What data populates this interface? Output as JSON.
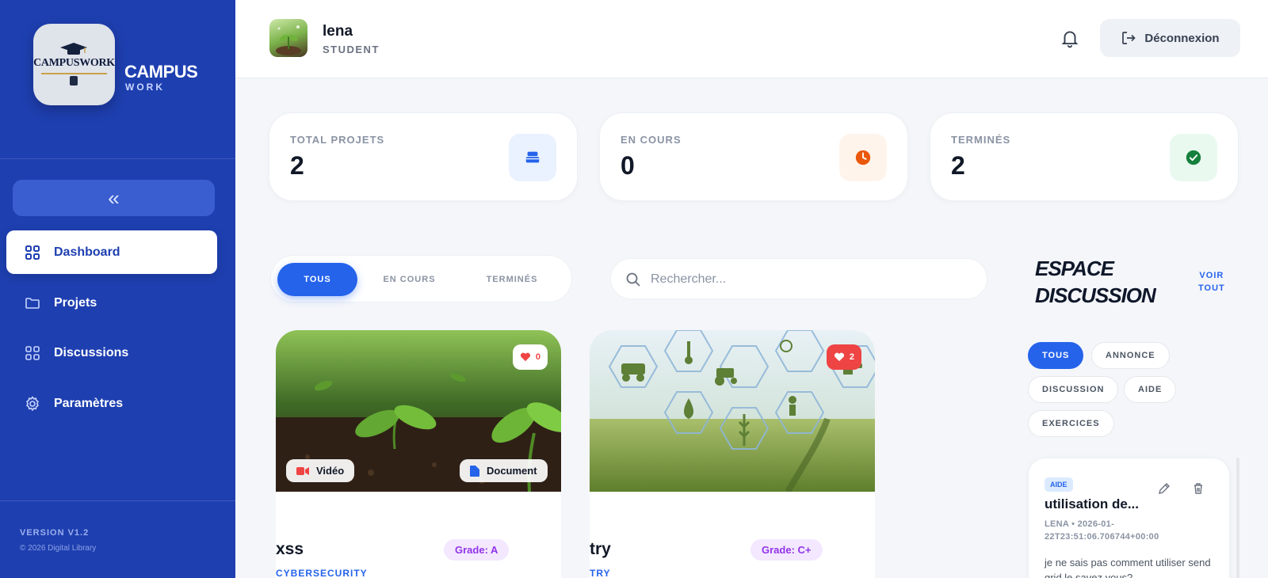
{
  "brand": {
    "logo_text": "CAMPUSWORK",
    "name_line1": "CAMPUS",
    "name_line2": "WORK"
  },
  "sidebar": {
    "collapse_label": "«",
    "items": [
      {
        "label": "Dashboard",
        "icon": "grid-icon",
        "active": true
      },
      {
        "label": "Projets",
        "icon": "folder-icon",
        "active": false
      },
      {
        "label": "Discussions",
        "icon": "grid-icon",
        "active": false
      },
      {
        "label": "Paramètres",
        "icon": "gear-icon",
        "active": false
      }
    ],
    "version": "VERSION V1.2",
    "copyright": "© 2026 Digital Library"
  },
  "header": {
    "user_name": "lena",
    "user_role": "STUDENT",
    "logout_label": "Déconnexion"
  },
  "stats": [
    {
      "label": "TOTAL PROJETS",
      "value": "2",
      "icon": "stack-icon",
      "color": "#2563eb"
    },
    {
      "label": "EN COURS",
      "value": "0",
      "icon": "clock-icon",
      "color": "#ea580c"
    },
    {
      "label": "TERMINÉS",
      "value": "2",
      "icon": "check-circle-icon",
      "color": "#16a34a"
    }
  ],
  "filters": {
    "tabs": [
      "TOUS",
      "EN COURS",
      "TERMINÉS"
    ],
    "active": "TOUS"
  },
  "search": {
    "placeholder": "Rechercher...",
    "value": ""
  },
  "projects": [
    {
      "title": "xss",
      "grade": "Grade: A",
      "category": "CYBERSECURITY",
      "likes": "0",
      "media": [
        "Vidéo",
        "Document"
      ]
    },
    {
      "title": "try",
      "grade": "Grade: C+",
      "category": "TRY",
      "likes": "2",
      "media": []
    }
  ],
  "discussion": {
    "title_line1": "ESPACE",
    "title_line2": "DISCUSSION",
    "voir_line1": "VOIR",
    "voir_line2": "TOUT",
    "chips": [
      "TOUS",
      "ANNONCE",
      "DISCUSSION",
      "AIDE",
      "EXERCICES"
    ],
    "active_chip": "TOUS",
    "post": {
      "tag": "AIDE",
      "title": "utilisation de...",
      "meta_line1": "LENA • 2026-01-",
      "meta_line2": "22T23:51:06.706744+00:00",
      "body": "je ne sais pas comment utiliser send grid le savez vous?"
    }
  },
  "colors": {
    "sidebar": "#1e3fb0",
    "accent": "#2563eb",
    "grade_text": "#9333ea",
    "like_red": "#ef4444"
  }
}
